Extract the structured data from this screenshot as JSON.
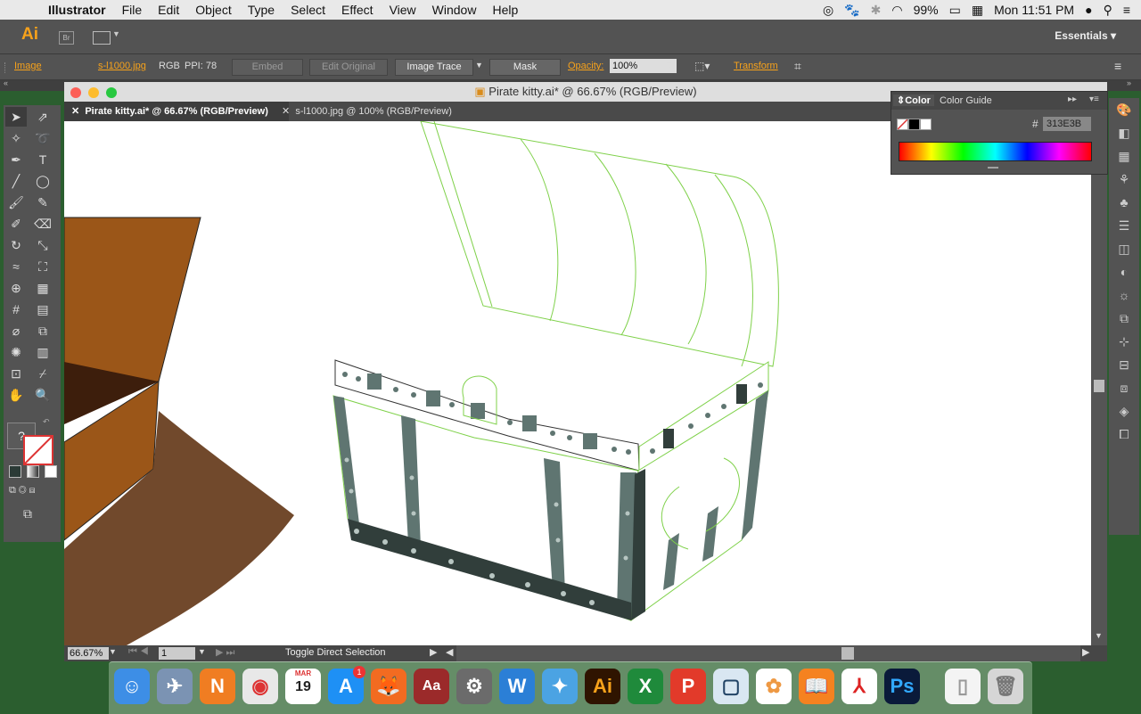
{
  "menubar": {
    "app_name": "Illustrator",
    "items": [
      "File",
      "Edit",
      "Object",
      "Type",
      "Select",
      "Effect",
      "View",
      "Window",
      "Help"
    ],
    "battery": "99%",
    "clock": "Mon 11:51 PM"
  },
  "appbar": {
    "logo": "Ai",
    "bridge": "Br",
    "workspace": "Essentials"
  },
  "control_bar": {
    "object_type": "Image",
    "file_link": "s-l1000.jpg",
    "color_mode": "RGB",
    "ppi": "PPI: 78",
    "embed": "Embed",
    "edit_original": "Edit Original",
    "image_trace": "Image Trace",
    "mask": "Mask",
    "opacity_label": "Opacity:",
    "opacity_value": "100%",
    "transform": "Transform"
  },
  "document": {
    "window_title": "Pirate kitty.ai* @ 66.67% (RGB/Preview)",
    "tabs": [
      "Pirate kitty.ai* @ 66.67% (RGB/Preview)",
      "s-l1000.jpg @ 100% (RGB/Preview)"
    ],
    "zoom": "66.67%",
    "page": "1",
    "status": "Toggle Direct Selection"
  },
  "color_panel": {
    "tabs": [
      "Color",
      "Color Guide"
    ],
    "hash": "#",
    "hex_value": "313E3B"
  },
  "dock": {
    "calendar_month": "MAR",
    "calendar_day": "19",
    "appstore_badge": "1"
  },
  "colors": {
    "ui_dark": "#535353",
    "accent_orange": "#f7a21b",
    "outline_green": "#7fd14a",
    "chest_dark": "#313E3B",
    "chest_slate": "#5f7571",
    "box_brown": "#9b5618",
    "box_shadow": "#3d1e0c",
    "floor_brown": "#71492c"
  }
}
